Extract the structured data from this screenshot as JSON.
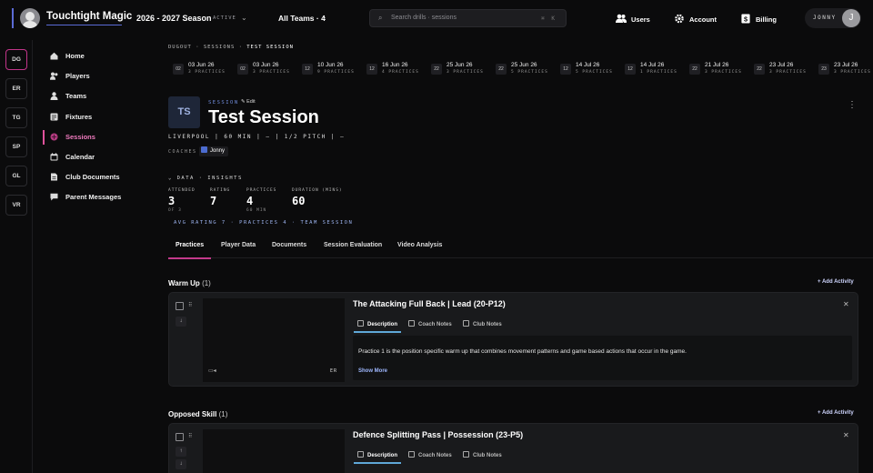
{
  "app": {
    "brand": "Touchtight Magic",
    "season": "2026 - 2027 Season",
    "season_badge": "ACTIVE",
    "teams_filter": "All Teams · 4",
    "search_placeholder": "Search drills · sessions",
    "search_shortcut": "⌘ K",
    "nav": {
      "users": "Users",
      "account": "Account",
      "billing": "Billing"
    },
    "user": {
      "name": "JONNY",
      "initial": "J"
    },
    "accent": "#c2358a"
  },
  "team_rail": [
    "DG",
    "ER",
    "TG",
    "SP",
    "GL",
    "VR"
  ],
  "sidebar": [
    {
      "label": "Home",
      "icon": "home-icon"
    },
    {
      "label": "Players",
      "icon": "players-icon"
    },
    {
      "label": "Teams",
      "icon": "teams-icon"
    },
    {
      "label": "Fixtures",
      "icon": "fixtures-icon"
    },
    {
      "label": "Sessions",
      "icon": "sessions-icon",
      "selected": true
    },
    {
      "label": "Calendar",
      "icon": "calendar-icon"
    },
    {
      "label": "Club Documents",
      "icon": "documents-icon"
    },
    {
      "label": "Parent Messages",
      "icon": "messages-icon"
    }
  ],
  "breadcrumb": {
    "a": "DUGOUT",
    "b": "SESSIONS",
    "c": "TEST SESSION",
    "sep": "·"
  },
  "dates": [
    {
      "num": "02",
      "date": "03 Jun 26",
      "practices": "3 PRACTICES"
    },
    {
      "num": "02",
      "date": "03 Jun 26",
      "practices": "3 PRACTICES"
    },
    {
      "num": "12",
      "date": "10 Jun 26",
      "practices": "9 PRACTICES"
    },
    {
      "num": "12",
      "date": "16 Jun 26",
      "practices": "4 PRACTICES"
    },
    {
      "num": "22",
      "date": "25 Jun 26",
      "practices": "3 PRACTICES"
    },
    {
      "num": "22",
      "date": "25 Jun 26",
      "practices": "5 PRACTICES"
    },
    {
      "num": "12",
      "date": "14 Jul 26",
      "practices": "5 PRACTICES"
    },
    {
      "num": "12",
      "date": "14 Jul 26",
      "practices": "1 PRACTICES"
    },
    {
      "num": "22",
      "date": "21 Jul 26",
      "practices": "3 PRACTICES"
    },
    {
      "num": "22",
      "date": "23 Jul 26",
      "practices": "3 PRACTICES"
    },
    {
      "num": "23",
      "date": "23 Jul 26",
      "practices": "3 PRACTICES"
    }
  ],
  "session": {
    "initials": "TS",
    "tag": "SESSION",
    "edit": "Edit",
    "title": "Test Session",
    "meta": "LIVERPOOL | 60 MIN | — | 1/2 PITCH | —",
    "coaches_label": "COACHES",
    "coach": "Jonny"
  },
  "insights": {
    "toggle": "DATA · INSIGHTS",
    "stats": [
      {
        "label": "ATTENDED",
        "value": "3",
        "sub": "OF 3"
      },
      {
        "label": "RATING",
        "value": "7",
        "sub": ""
      },
      {
        "label": "PRACTICES",
        "value": "4",
        "sub": "60 MIN"
      },
      {
        "label": "DURATION (MINS)",
        "value": "60",
        "sub": ""
      }
    ],
    "summary": "AVG RATING 7 · PRACTICES 4 · TEAM SESSION"
  },
  "tabs": [
    "Practices",
    "Player Data",
    "Documents",
    "Session Evaluation",
    "Video Analysis"
  ],
  "sections": [
    {
      "title": "Warm Up",
      "count": "(1)",
      "add": "Add Activity",
      "card": {
        "title": "The Attacking Full Back | Lead (20-P12)",
        "tabs": [
          "Description",
          "Coach Notes",
          "Club Notes"
        ],
        "description": "Practice 1 is the position specific warm up that combines movement patterns and game based actions that occur in the game.",
        "show_more": "Show More",
        "code": "ER"
      }
    },
    {
      "title": "Opposed Skill",
      "count": "(1)",
      "add": "Add Activity",
      "card": {
        "title": "Defence Splitting Pass | Possession (23-P5)",
        "tabs": [
          "Description",
          "Coach Notes",
          "Club Notes"
        ]
      }
    }
  ]
}
